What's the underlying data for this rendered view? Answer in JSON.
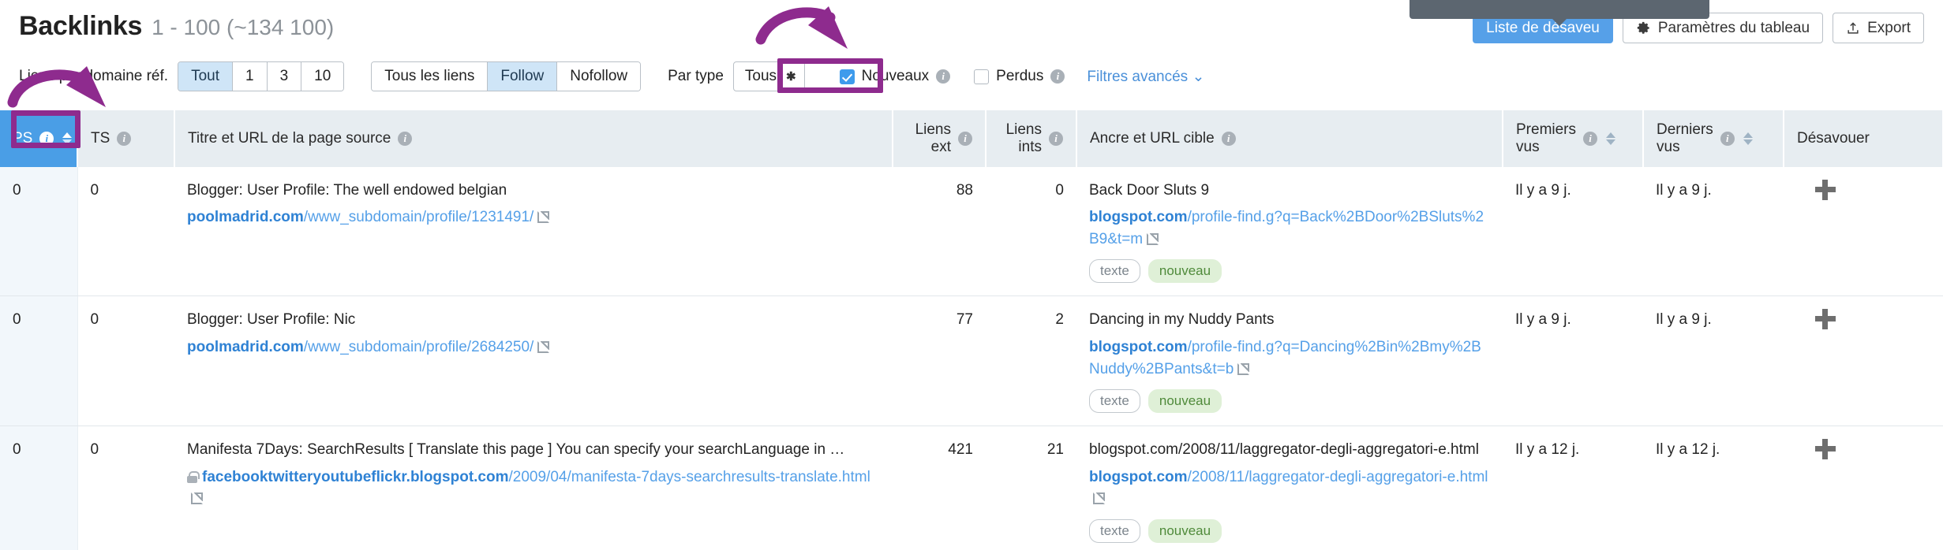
{
  "header": {
    "title": "Backlinks",
    "range_count": "1 - 100 (~134 100)",
    "actions": {
      "disavow_label": "Liste de désaveu",
      "table_settings_label": "Paramètres du tableau",
      "table_settings_icon": "gear-icon",
      "export_label": "Export",
      "export_icon": "upload-icon"
    }
  },
  "filters": {
    "links_per_domain_label": "Liens par domaine réf.",
    "links_per_domain_options": [
      "Tout",
      "1",
      "3",
      "10"
    ],
    "links_per_domain_active": "Tout",
    "follow_options": [
      "Tous les liens",
      "Follow",
      "Nofollow"
    ],
    "follow_active": "Follow",
    "type_label": "Par type",
    "type_value": "Tous",
    "type_chevron_icon": "chevron-down-icon",
    "new_label": "Nouveaux",
    "new_checked": true,
    "lost_label": "Perdus",
    "lost_checked": false,
    "advanced_label": "Filtres avancés",
    "advanced_chevron_icon": "chevron-down-icon",
    "info_icon": "info-icon"
  },
  "table": {
    "columns": [
      {
        "key": "ps",
        "label": "PS",
        "info": true,
        "sortable": true,
        "sorted": true,
        "align": "left"
      },
      {
        "key": "ts",
        "label": "TS",
        "info": true,
        "sortable": false,
        "align": "left"
      },
      {
        "key": "source",
        "label": "Titre et URL de la page source",
        "info": true,
        "sortable": false,
        "align": "left"
      },
      {
        "key": "ext",
        "label": "Liens ext",
        "label_l1": "Liens",
        "label_l2": "ext",
        "info": true,
        "sortable": false,
        "align": "right"
      },
      {
        "key": "ints",
        "label": "Liens ints",
        "label_l1": "Liens",
        "label_l2": "ints",
        "info": true,
        "sortable": false,
        "align": "right"
      },
      {
        "key": "anchor",
        "label": "Ancre et URL cible",
        "info": true,
        "sortable": false,
        "align": "left"
      },
      {
        "key": "first",
        "label": "Premiers vus",
        "label_l1": "Premiers",
        "label_l2": "vus",
        "info": true,
        "sortable": true,
        "align": "left"
      },
      {
        "key": "last",
        "label": "Derniers vus",
        "label_l1": "Derniers",
        "label_l2": "vus",
        "info": true,
        "sortable": true,
        "align": "left"
      },
      {
        "key": "disavow",
        "label": "Désavouer",
        "info": false,
        "sortable": false,
        "align": "left"
      }
    ],
    "rows": [
      {
        "ps": "0",
        "ts": "0",
        "source_title": "Blogger: User Profile: The well endowed belgian",
        "source_domain": "poolmadrid.com",
        "source_path": "/www_subdomain/profile/1231491/",
        "source_secure": false,
        "ext": "88",
        "ints": "0",
        "anchor_text": "Back Door Sluts 9",
        "anchor_is_link": true,
        "target_domain": "blogspot.com",
        "target_path": "/profile-find.g?q=Back%2BDoor%2BSluts%2B9&t=m",
        "badges": [
          "texte",
          "nouveau"
        ],
        "first_seen": "Il y a 9 j.",
        "last_seen": "Il y a 9 j.",
        "disavow_icon": "plus-icon"
      },
      {
        "ps": "0",
        "ts": "0",
        "source_title": "Blogger: User Profile: Nic",
        "source_domain": "poolmadrid.com",
        "source_path": "/www_subdomain/profile/2684250/",
        "source_secure": false,
        "ext": "77",
        "ints": "2",
        "anchor_text": "Dancing in my Nuddy Pants",
        "anchor_is_link": true,
        "target_domain": "blogspot.com",
        "target_path": "/profile-find.g?q=Dancing%2Bin%2Bmy%2BNuddy%2BPants&t=b",
        "badges": [
          "texte",
          "nouveau"
        ],
        "first_seen": "Il y a 9 j.",
        "last_seen": "Il y a 9 j.",
        "disavow_icon": "plus-icon"
      },
      {
        "ps": "0",
        "ts": "0",
        "source_title": "Manifesta 7Days: SearchResults [ Translate this page ] You can specify your searchLanguage in …",
        "source_domain": "facebooktwitteryoutubeflickr.blogspot.com",
        "source_path": "/2009/04/manifesta-7days-searchresults-translate.html",
        "source_secure": true,
        "ext": "421",
        "ints": "21",
        "anchor_text": "blogspot.com/2008/11/laggregator-degli-aggregatori-e.html",
        "anchor_is_link": false,
        "target_domain": "blogspot.com",
        "target_path": "/2008/11/laggregator-degli-aggregatori-e.html",
        "badges": [
          "texte",
          "nouveau"
        ],
        "first_seen": "Il y a 12 j.",
        "last_seen": "Il y a 12 j.",
        "disavow_icon": "plus-icon"
      }
    ]
  },
  "annotations": {
    "accent_color": "#8e2b8e",
    "highlight_sort_column": "PS",
    "highlight_checkbox": "Nouveaux"
  },
  "colors": {
    "primary_blue": "#56a0e8",
    "header_bg": "#e7edf1",
    "sorted_header_bg": "#4a9ee6",
    "green_badge_bg": "#dff0d7",
    "green_text": "#5a9c42",
    "link_blue": "#55a0e8",
    "annotation_purple": "#8e2b8e"
  }
}
